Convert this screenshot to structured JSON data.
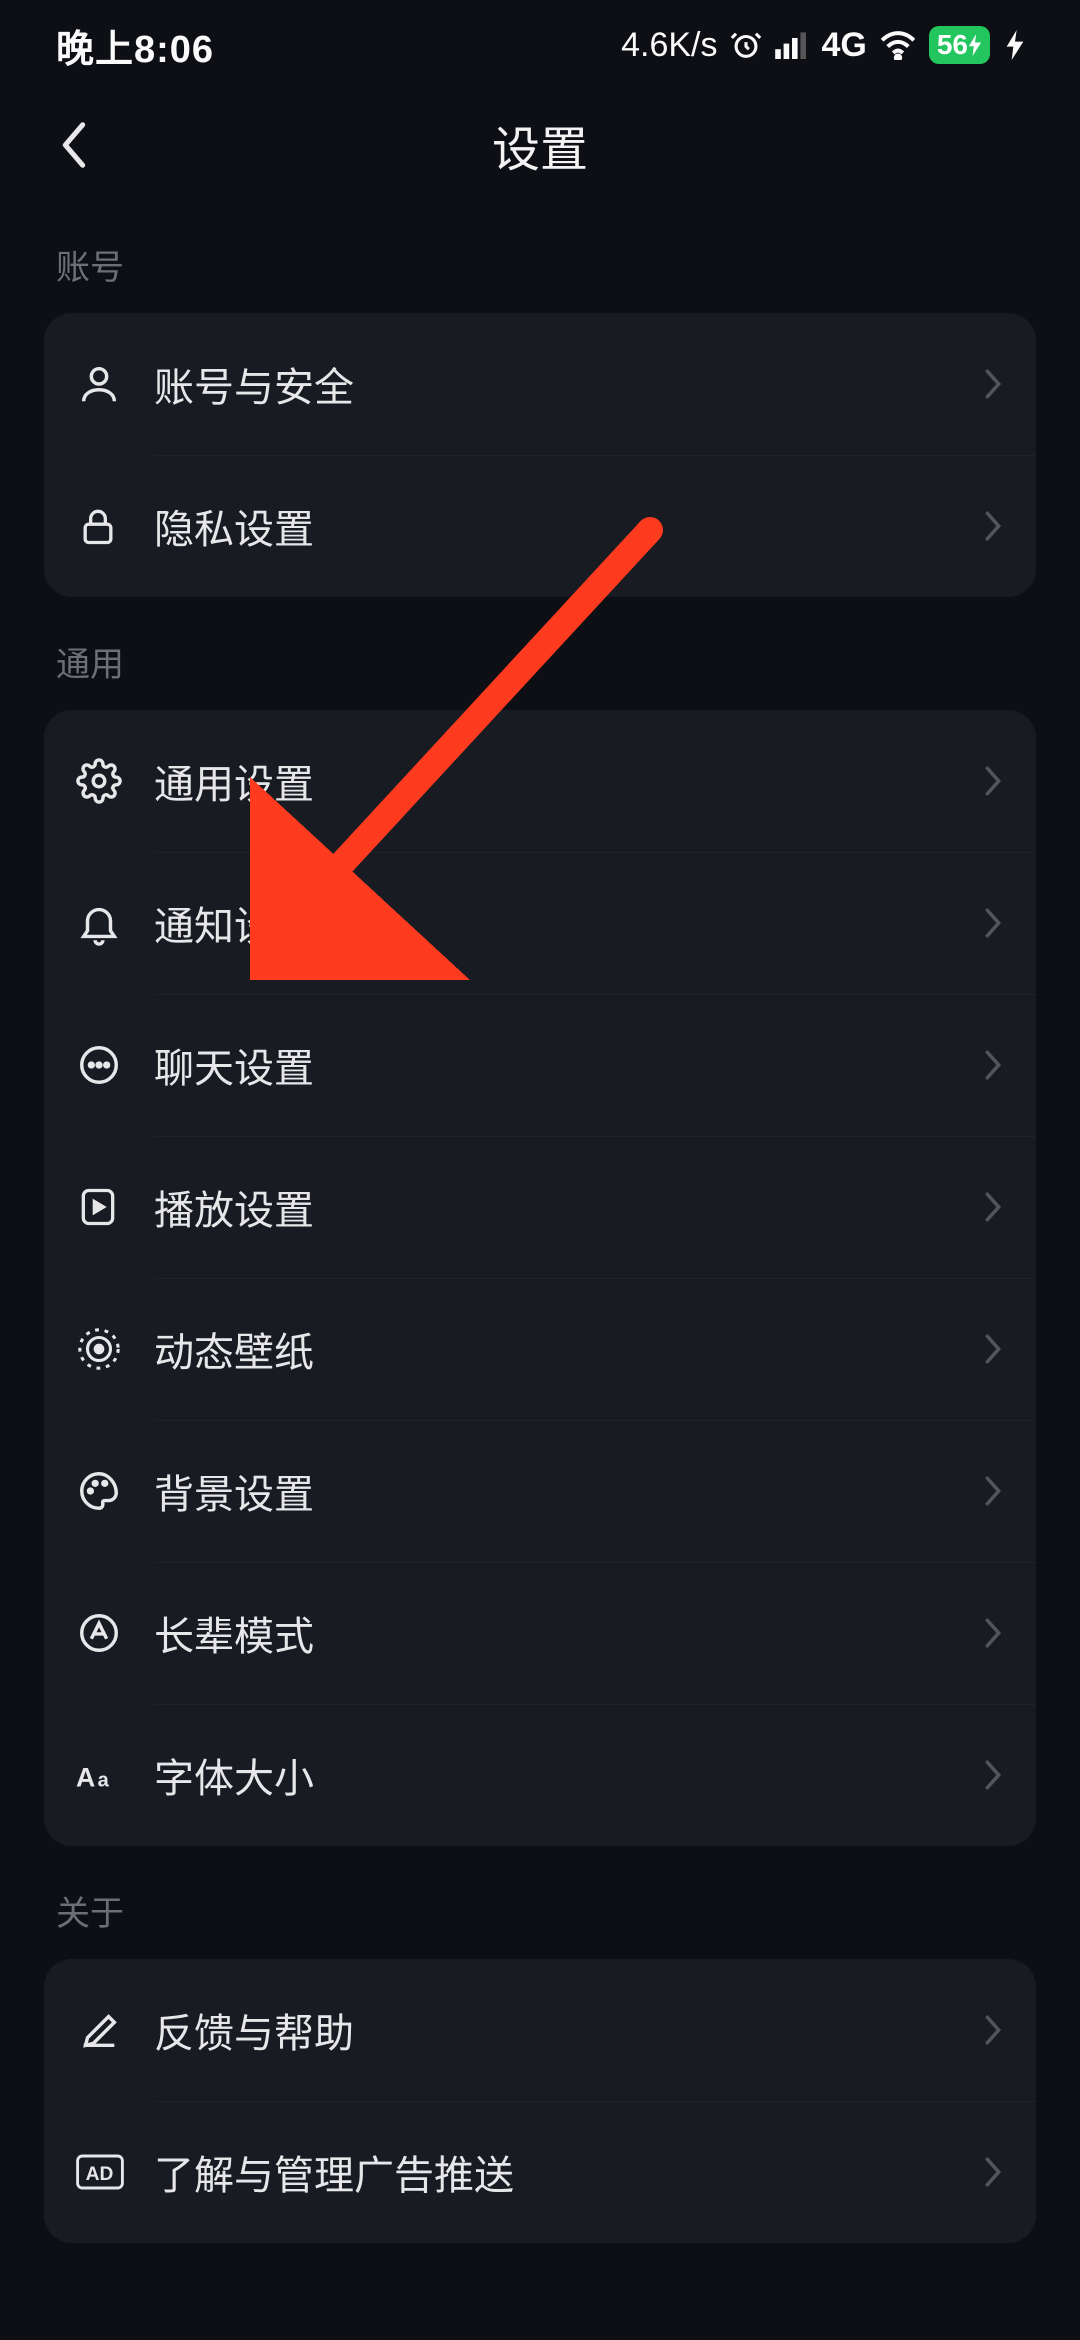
{
  "status": {
    "time": "晚上8:06",
    "speed": "4.6K/s",
    "network_label": "4G",
    "battery_text": "56"
  },
  "nav": {
    "title": "设置"
  },
  "sections": {
    "account": {
      "label": "账号",
      "items": [
        {
          "label": "账号与安全"
        },
        {
          "label": "隐私设置"
        }
      ]
    },
    "general": {
      "label": "通用",
      "items": [
        {
          "label": "通用设置"
        },
        {
          "label": "通知设置"
        },
        {
          "label": "聊天设置"
        },
        {
          "label": "播放设置"
        },
        {
          "label": "动态壁纸"
        },
        {
          "label": "背景设置"
        },
        {
          "label": "长辈模式"
        },
        {
          "label": "字体大小"
        }
      ]
    },
    "about": {
      "label": "关于",
      "items": [
        {
          "label": "反馈与帮助"
        },
        {
          "label": "了解与管理广告推送"
        }
      ]
    }
  }
}
